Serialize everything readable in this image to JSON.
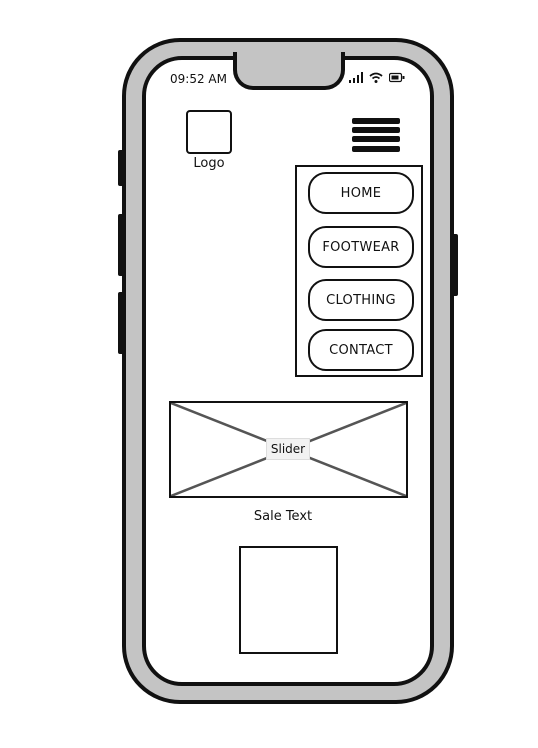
{
  "status_bar": {
    "time": "09:52 AM",
    "icons": [
      "signal-icon",
      "wifi-icon",
      "battery-icon"
    ]
  },
  "header": {
    "logo_label": "Logo",
    "menu_icon": "hamburger-menu-icon"
  },
  "nav": {
    "items": [
      {
        "label": "HOME"
      },
      {
        "label": "FOOTWEAR"
      },
      {
        "label": "CLOTHING"
      },
      {
        "label": "CONTACT"
      }
    ]
  },
  "slider": {
    "label": "Slider"
  },
  "sale_text": "Sale Text",
  "colors": {
    "frame": "#c4c4c4",
    "stroke": "#111111",
    "screen": "#ffffff"
  }
}
